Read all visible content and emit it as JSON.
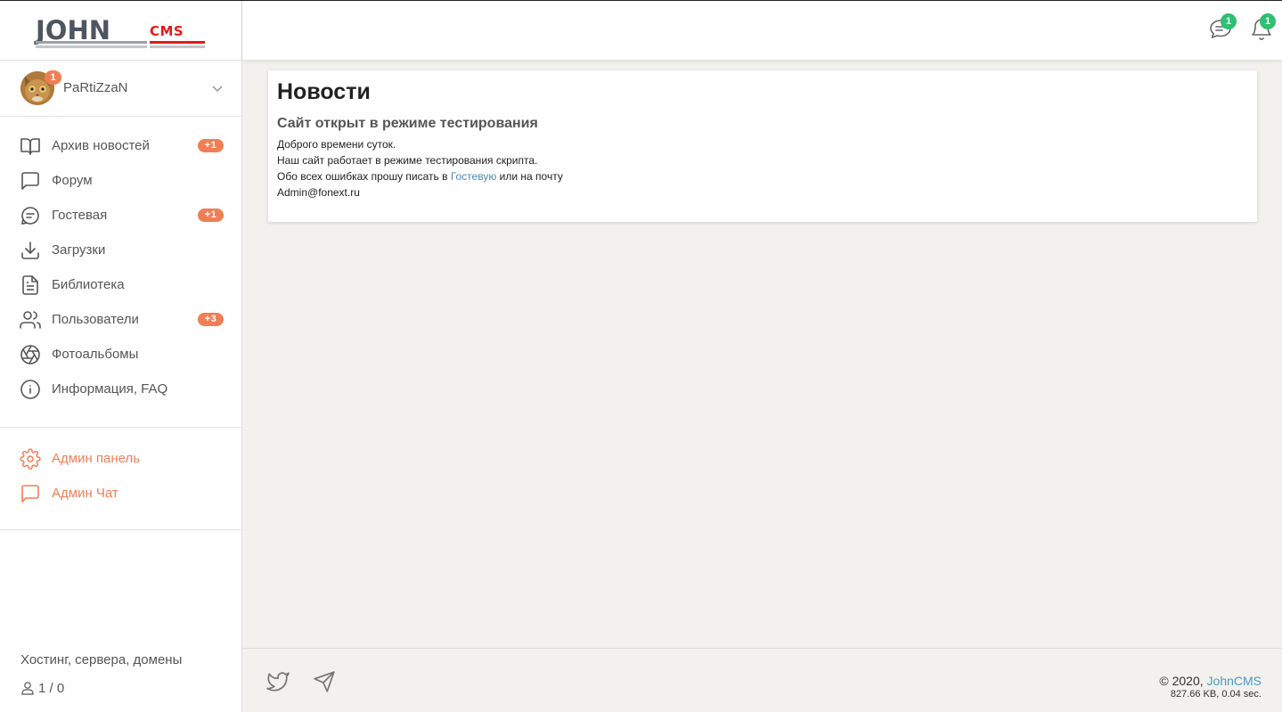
{
  "logo": {
    "main": "JOHN",
    "sub": "CMS"
  },
  "user": {
    "name": "PaRtiZzaN",
    "badge": "1"
  },
  "nav": {
    "items": [
      {
        "label": "Архив новостей",
        "badge": "+1",
        "icon": "book-icon"
      },
      {
        "label": "Форум",
        "badge": "",
        "icon": "message-square-icon"
      },
      {
        "label": "Гостевая",
        "badge": "+1",
        "icon": "guestbook-icon"
      },
      {
        "label": "Загрузки",
        "badge": "",
        "icon": "download-icon"
      },
      {
        "label": "Библиотека",
        "badge": "",
        "icon": "file-text-icon"
      },
      {
        "label": "Пользователи",
        "badge": "+3",
        "icon": "users-icon"
      },
      {
        "label": "Фотоальбомы",
        "badge": "",
        "icon": "aperture-icon"
      },
      {
        "label": "Информация, FAQ",
        "badge": "",
        "icon": "info-icon"
      }
    ]
  },
  "admin": {
    "items": [
      {
        "label": "Админ панель",
        "icon": "settings-icon"
      },
      {
        "label": "Админ Чат",
        "icon": "chat-icon"
      }
    ]
  },
  "sidebar_footer": {
    "hosting": "Хостинг, сервера, домены",
    "online": "1 / 0"
  },
  "header": {
    "messages_badge": "1",
    "notifications_badge": "1"
  },
  "main": {
    "title": "Новости",
    "news_title": "Сайт открыт в режиме тестирования",
    "line1": "Доброго времени суток.",
    "line2": "Наш сайт работает в режиме тестирования скрипта.",
    "line3_before": "Обо всех ошибках прошу писать в ",
    "line3_link": "Гостевую",
    "line3_after": " или на почту",
    "line4": "Admin@fonext.ru"
  },
  "footer": {
    "copyright_prefix": "© 2020, ",
    "copyright_link": "JohnCMS",
    "stats": "827.66 KB, 0.04 sec."
  },
  "colors": {
    "accent": "#f07e54",
    "green": "#2fbf71",
    "link": "#4b9ac6",
    "background": "#f2f1ee"
  }
}
